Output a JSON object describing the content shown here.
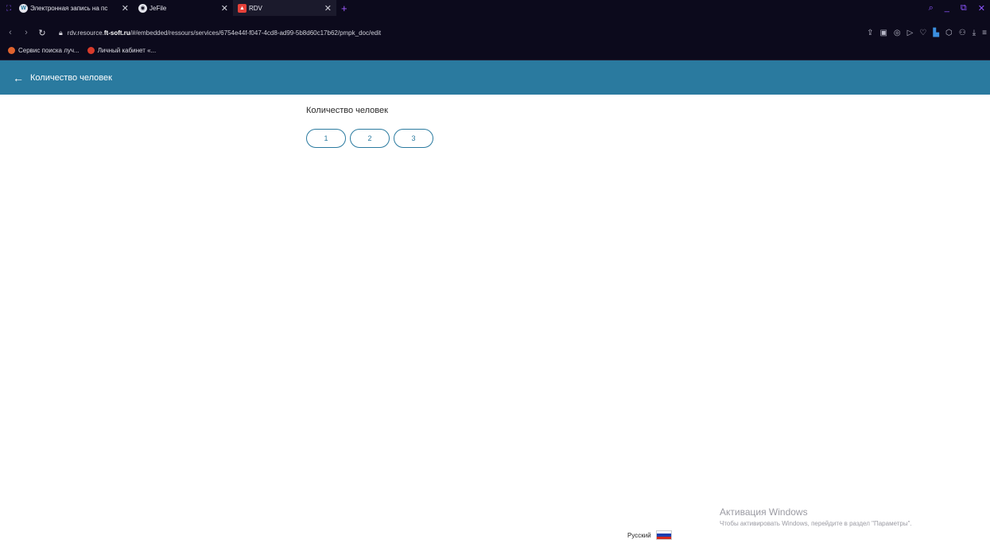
{
  "browser": {
    "tabs": [
      {
        "title": "Электронная запись на пс",
        "active": false
      },
      {
        "title": "JeFile",
        "active": false
      },
      {
        "title": "RDV",
        "active": true
      }
    ],
    "new_tab": "+",
    "url_prefix": "rdv.resource.",
    "url_domain": "ft-soft.ru",
    "url_path": "/#/embedded/ressours/services/6754e44f-f047-4cd8-ad99-5b8d60c17b62/pmpk_doc/edit",
    "bookmarks": [
      {
        "label": "Сервис поиска луч..."
      },
      {
        "label": "Личный кабинет «..."
      }
    ]
  },
  "app": {
    "header_title": "Количество человек",
    "question_label": "Количество человек",
    "options": [
      "1",
      "2",
      "3"
    ],
    "language_label": "Русский"
  },
  "watermark": {
    "line1": "Активация Windows",
    "line2": "Чтобы активировать Windows, перейдите в раздел \"Параметры\"."
  },
  "colors": {
    "accent": "#2a7a9f",
    "browser_bg": "#0c0a1c",
    "browser_accent": "#8c55ff"
  },
  "icons": {
    "back": "arrow-left-icon",
    "lock": "lock-icon",
    "flag": "russia-flag-icon"
  }
}
